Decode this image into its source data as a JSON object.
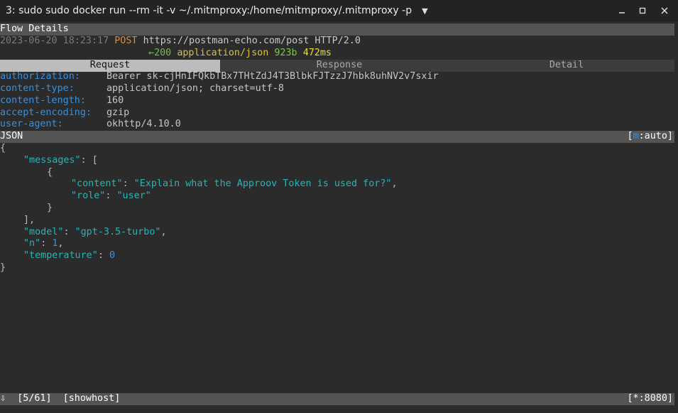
{
  "window": {
    "title": "3: sudo sudo docker run --rm -it -v ~/.mitmproxy:/home/mitmproxy/.mitmproxy -p",
    "dropdown_icon": "▼",
    "min_icon": "▁",
    "max_icon": "□",
    "close_icon": "✕"
  },
  "flow": {
    "section_title": "Flow Details",
    "timestamp": "2023-06-20 18:23:17",
    "method": "POST",
    "url": "https://postman-echo.com/post HTTP/2.0",
    "arrow": "←",
    "status_code": "200",
    "content_type": "application/json",
    "size": "923b",
    "duration": "472ms"
  },
  "tabs": {
    "request": "Request",
    "response": "Response",
    "detail": "Detail"
  },
  "headers": [
    {
      "key": "authorization:",
      "value": "Bearer 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"
    },
    {
      "key": "content-type:",
      "value": "application/json; charset=utf-8"
    },
    {
      "key": "content-length:",
      "value": "160"
    },
    {
      "key": "accept-encoding:",
      "value": "gzip"
    },
    {
      "key": "user-agent:",
      "value": "okhttp/4.10.0"
    }
  ],
  "body_bar": {
    "label": "JSON",
    "mode_open": "[",
    "mode_key": "m",
    "mode_rest": ":auto]"
  },
  "json": {
    "open_brace": "{",
    "messages_key": "\"messages\"",
    "colon": ": ",
    "open_bracket": "[",
    "item_open": "{",
    "content_key": "\"content\"",
    "content_value": "\"Explain what the Approov Token is used for?\"",
    "comma": ",",
    "role_key": "\"role\"",
    "role_value": "\"user\"",
    "item_close": "}",
    "close_bracket": "],",
    "model_key": "\"model\"",
    "model_value": "\"gpt-3.5-turbo\"",
    "n_key": "\"n\"",
    "n_value": "1",
    "temperature_key": "\"temperature\"",
    "temperature_value": "0",
    "close_brace": "}"
  },
  "status": {
    "scroll_icon": "⇩",
    "position": "[5/61]",
    "option": "[showhost]",
    "port": "[*:8080]"
  }
}
